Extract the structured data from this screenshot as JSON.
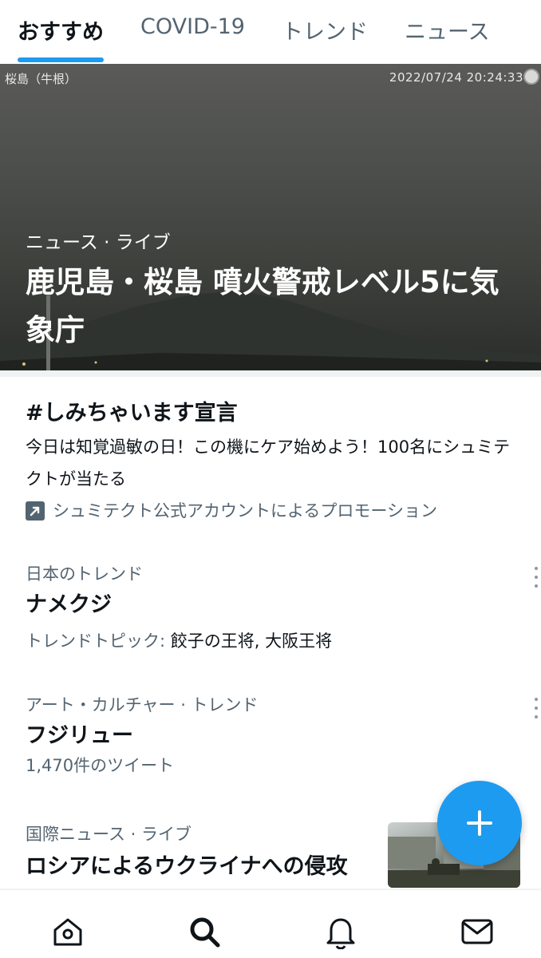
{
  "tabs": [
    {
      "label": "おすすめ",
      "active": true
    },
    {
      "label": "COVID-19",
      "active": false
    },
    {
      "label": "トレンド",
      "active": false
    },
    {
      "label": "ニュース",
      "active": false
    }
  ],
  "hero": {
    "image_caption_left": "桜島（牛根）",
    "image_caption_right": "2022/07/24 20:24:33",
    "category": "ニュース · ライブ",
    "title": "鹿児島・桜島 噴火警戒レベル5に気象庁"
  },
  "promo": {
    "title": "#しみちゃいます宣言",
    "description": "今日は知覚過敏の日！この機にケア始めよう！100名にシュミテクトが当たる",
    "promoted_by": "シュミテクト公式アカウントによるプロモーション",
    "icon": "promoted-arrow-icon"
  },
  "trends": [
    {
      "meta": "日本のトレンド",
      "name": "ナメクジ",
      "sub_prefix": "トレンドトピック: ",
      "sub_value": "餃子の王将, 大阪王将"
    },
    {
      "meta": "アート・カルチャー · トレンド",
      "name": "フジリュー",
      "sub_prefix": "1,470件のツイート"
    },
    {
      "meta": "国際ニュース · ライブ",
      "name": "ロシアによるウクライナへの侵攻"
    }
  ],
  "fab": {
    "icon": "plus-icon"
  },
  "bottom_nav": [
    {
      "icon": "home-icon"
    },
    {
      "icon": "search-icon"
    },
    {
      "icon": "bell-icon"
    },
    {
      "icon": "mail-icon"
    }
  ],
  "colors": {
    "accent": "#1d9bf0",
    "text_primary": "#0f1419",
    "text_secondary": "#536471"
  }
}
